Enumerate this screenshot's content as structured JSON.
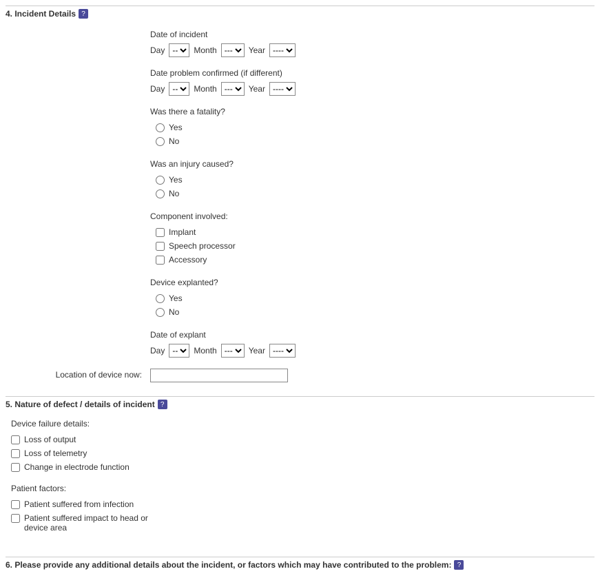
{
  "section4": {
    "header": "4. Incident Details",
    "date_incident": {
      "label": "Date of incident",
      "day_label": "Day",
      "day_value": "--",
      "month_label": "Month",
      "month_value": "---",
      "year_label": "Year",
      "year_value": "----"
    },
    "date_confirmed": {
      "label": "Date problem confirmed (if different)",
      "day_label": "Day",
      "day_value": "--",
      "month_label": "Month",
      "month_value": "---",
      "year_label": "Year",
      "year_value": "----"
    },
    "fatality": {
      "label": "Was there a fatality?",
      "yes": "Yes",
      "no": "No"
    },
    "injury": {
      "label": "Was an injury caused?",
      "yes": "Yes",
      "no": "No"
    },
    "component": {
      "label": "Component involved:",
      "implant": "Implant",
      "speech": "Speech processor",
      "accessory": "Accessory"
    },
    "explanted": {
      "label": "Device explanted?",
      "yes": "Yes",
      "no": "No"
    },
    "date_explant": {
      "label": "Date of explant",
      "day_label": "Day",
      "day_value": "--",
      "month_label": "Month",
      "month_value": "---",
      "year_label": "Year",
      "year_value": "----"
    },
    "location": {
      "label": "Location of device now:",
      "value": ""
    }
  },
  "section5": {
    "header": "5. Nature of defect / details of incident",
    "device_failure": {
      "label": "Device failure details:",
      "loss_output": "Loss of output",
      "loss_telemetry": "Loss of telemetry",
      "electrode": "Change in electrode function"
    },
    "patient_factors": {
      "label": "Patient factors:",
      "infection": "Patient suffered from infection",
      "impact": "Patient suffered impact to head or device area"
    }
  },
  "section6": {
    "header": "6. Please provide any additional details about the incident, or factors which may have contributed to the problem:"
  },
  "help_symbol": "?"
}
